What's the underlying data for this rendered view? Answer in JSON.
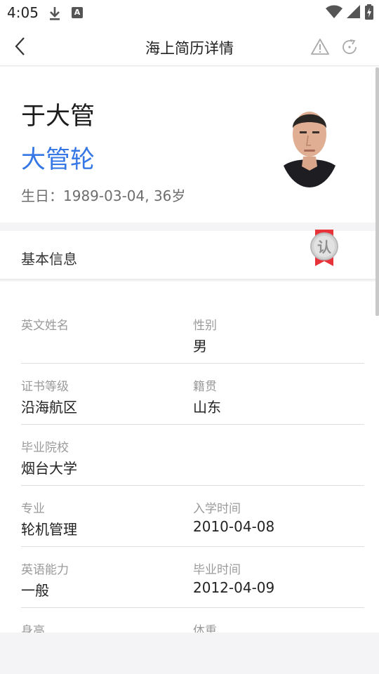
{
  "status": {
    "time": "4:05",
    "a_icon": "A"
  },
  "nav": {
    "title": "海上简历详情"
  },
  "profile": {
    "name": "于大管",
    "position": "大管轮",
    "birthday": "生日：1989-03-04, 36岁"
  },
  "section": {
    "title": "基本信息",
    "badge_text": "认"
  },
  "rows": [
    {
      "left_label": "英文姓名",
      "left_value": "",
      "right_label": "性别",
      "right_value": "男"
    },
    {
      "left_label": "证书等级",
      "left_value": "沿海航区",
      "right_label": "籍贯",
      "right_value": "山东"
    },
    {
      "left_label": "毕业院校",
      "left_value": "烟台大学",
      "right_label": "",
      "right_value": ""
    },
    {
      "left_label": "专业",
      "left_value": "轮机管理",
      "right_label": "入学时间",
      "right_value": "2010-04-08"
    },
    {
      "left_label": "英语能力",
      "left_value": "一般",
      "right_label": "毕业时间",
      "right_value": "2012-04-09"
    },
    {
      "left_label": "身高",
      "left_value": "",
      "right_label": "体重",
      "right_value": ""
    }
  ],
  "colors": {
    "accent": "#3577e5",
    "badge_red": "#e8323a"
  }
}
